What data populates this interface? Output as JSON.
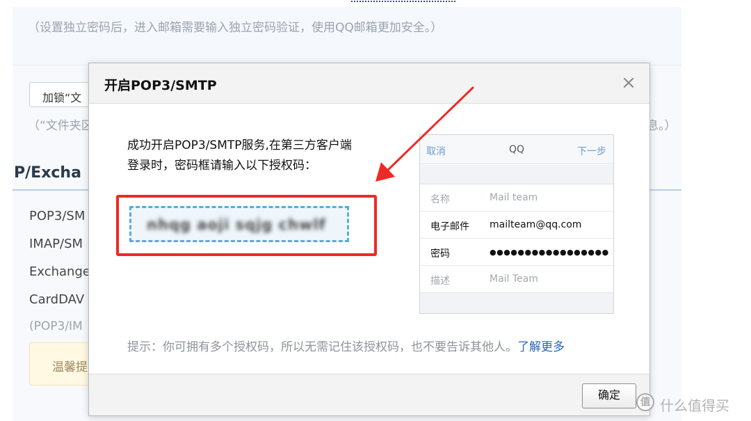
{
  "background": {
    "note_top": "（设置独立密码后，进入邮箱需要输入独立密码验证，使用QQ邮箱更加安全。）",
    "lock_button": "加锁“文",
    "note_folder": "（“文件夹区",
    "note_folder_tail": "息。）",
    "section_heading": "P/Excha",
    "protocols": [
      "POP3/SM",
      "IMAP/SM",
      "Exchange",
      "CardDAV"
    ],
    "protocol_note": "(POP3/IM",
    "tip_box": "温馨提"
  },
  "dialog": {
    "title": "开启POP3/SMTP",
    "close_glyph": "×",
    "message_line1": "成功开启POP3/SMTP服务,在第三方客户端",
    "message_line2": "登录时，密码框请输入以下授权码：",
    "auth_code": "nhqg aoji sqjg chwlf",
    "hint_text": "提示：你可拥有多个授权码，所以无需记住该授权码，也不要告诉其他人。",
    "hint_link": "了解更多",
    "ok_button": "确定"
  },
  "phone_preview": {
    "cancel": "取消",
    "title": "QQ",
    "next": "下一步",
    "rows": [
      {
        "label": "名称",
        "value": "Mail team"
      },
      {
        "label": "电子邮件",
        "value": "mailteam@qq.com"
      },
      {
        "label": "密码",
        "value": "●●●●●●●●●●●●●●●●●"
      },
      {
        "label": "描述",
        "value": "Mail Team"
      }
    ]
  },
  "watermark": {
    "logo": "值",
    "text": "什么值得买"
  },
  "colors": {
    "annotation_red": "#ee2a24",
    "link_blue": "#2a65b8",
    "dashed_blue": "#59acd8"
  }
}
